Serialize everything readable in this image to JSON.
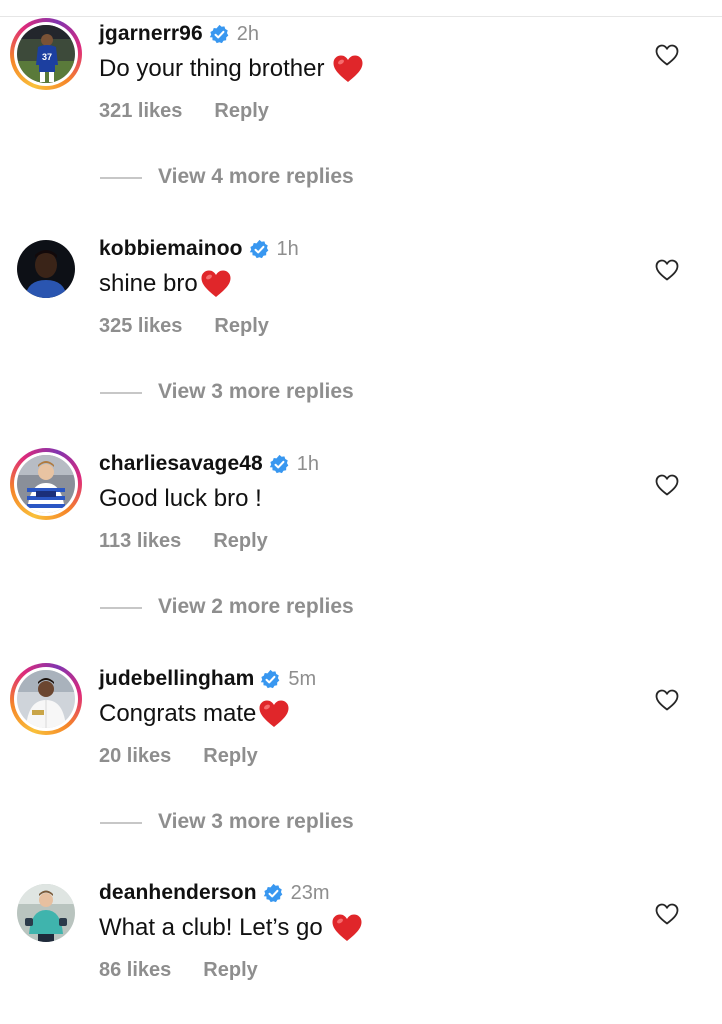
{
  "comments": [
    {
      "username": "jgarnerr96",
      "time": "2h",
      "text": "Do your thing brother",
      "emoji": "heart-emoji",
      "emoji_spaced": true,
      "likes": "321 likes",
      "reply": "Reply",
      "more_replies": "View 4 more replies",
      "avatar_icon": "avatar-player-blue-kit",
      "story_ring": true
    },
    {
      "username": "kobbiemainoo",
      "time": "1h",
      "text": "shine bro",
      "emoji": "heart-emoji",
      "emoji_spaced": false,
      "likes": "325 likes",
      "reply": "Reply",
      "more_replies": "View 3 more replies",
      "avatar_icon": "avatar-portrait-dark",
      "story_ring": false
    },
    {
      "username": "charliesavage48",
      "time": "1h",
      "text": "Good luck bro !",
      "emoji": "",
      "likes": "113 likes",
      "reply": "Reply",
      "more_replies": "View 2 more replies",
      "avatar_icon": "avatar-player-hooped-kit",
      "story_ring": true
    },
    {
      "username": "judebellingham",
      "time": "5m",
      "text": "Congrats mate",
      "emoji": "heart-emoji",
      "emoji_spaced": false,
      "likes": "20 likes",
      "reply": "Reply",
      "more_replies": "View 3 more replies",
      "avatar_icon": "avatar-player-white-kit",
      "story_ring": true
    },
    {
      "username": "deanhenderson",
      "time": "23m",
      "text": "What a club! Let’s go",
      "emoji": "heart-emoji",
      "emoji_spaced": true,
      "likes": "86 likes",
      "reply": "Reply",
      "avatar_icon": "avatar-goalkeeper",
      "story_ring": false
    }
  ],
  "colors": {
    "verified_badge": "#3897f0",
    "secondary_text": "#8e8e8e",
    "heart_emoji": "#e0262a"
  }
}
